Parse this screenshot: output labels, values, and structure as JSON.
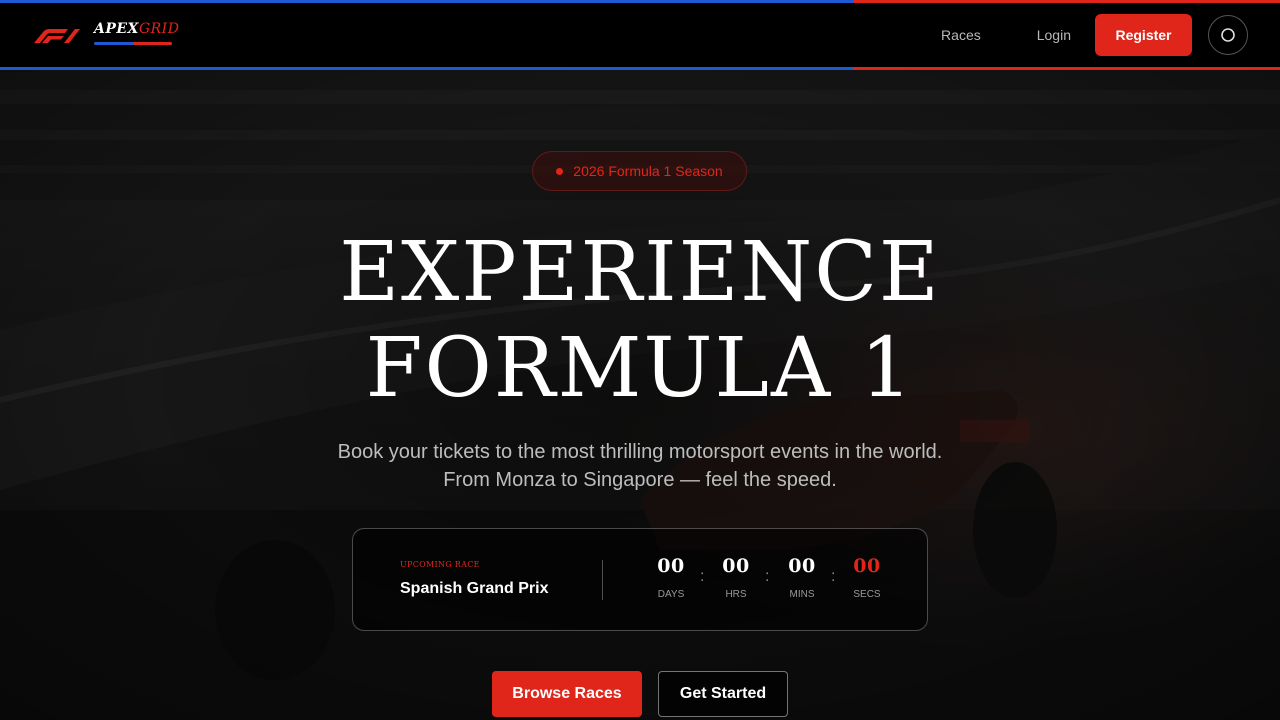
{
  "brand": {
    "name_part1": "APEX",
    "name_part2": "GRID",
    "accent_red": "#e0261b",
    "accent_blue": "#1e5ad6"
  },
  "nav": {
    "races_label": "Races",
    "login_label": "Login",
    "register_label": "Register",
    "theme_icon": "circle-icon"
  },
  "hero": {
    "season_badge": "2026 Formula 1 Season",
    "title_line1": "EXPERIENCE",
    "title_line2": "FORMULA 1",
    "subtitle_line1": "Book your tickets to the most thrilling motorsport events in the world.",
    "subtitle_line2": "From Monza to Singapore — feel the speed."
  },
  "countdown": {
    "label": "Upcoming Race",
    "race_name": "Spanish Grand Prix",
    "units": [
      {
        "value": "00",
        "caption": "DAYS"
      },
      {
        "value": "00",
        "caption": "HRS"
      },
      {
        "value": "00",
        "caption": "MINS"
      },
      {
        "value": "00",
        "caption": "SECS"
      }
    ],
    "separator": ":"
  },
  "cta": {
    "browse_label": "Browse Races",
    "start_label": "Get Started"
  }
}
